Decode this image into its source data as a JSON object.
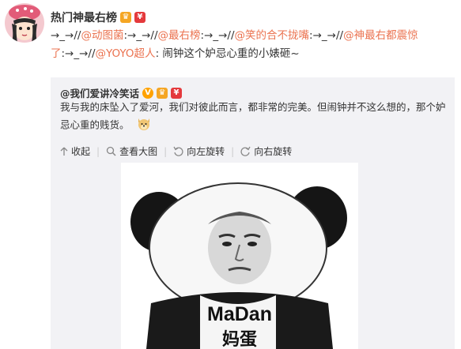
{
  "author": {
    "name": "热门神最右榜"
  },
  "post": {
    "segments": [
      {
        "t": "→_→//",
        "link": false
      },
      {
        "t": "@动图菌",
        "link": true
      },
      {
        "t": ":→_→//",
        "link": false
      },
      {
        "t": "@最右榜",
        "link": true
      },
      {
        "t": ":→_→//",
        "link": false
      },
      {
        "t": "@笑的合不拢嘴",
        "link": true
      },
      {
        "t": ":→_→//",
        "link": false
      },
      {
        "t": "@神最右都震惊了",
        "link": true
      },
      {
        "t": ":→_→//",
        "link": false
      },
      {
        "t": "@YOYO超人",
        "link": true
      },
      {
        "t": ": 闹钟这个妒忌心重的小婊砸~",
        "link": false
      }
    ]
  },
  "repost": {
    "author": "@我们爱讲冷笑话",
    "text": "我与我的床坠入了爱河，我们对彼此而言，都非常的完美。但闹钟并不这么想的，那个妒忌心重的贱货。",
    "actions": {
      "collect": "收起",
      "view_large": "查看大图",
      "rotate_left": "向左旋转",
      "rotate_right": "向右旋转"
    },
    "image": {
      "caption_en": "MaDan",
      "caption_zh": "妈蛋"
    }
  }
}
